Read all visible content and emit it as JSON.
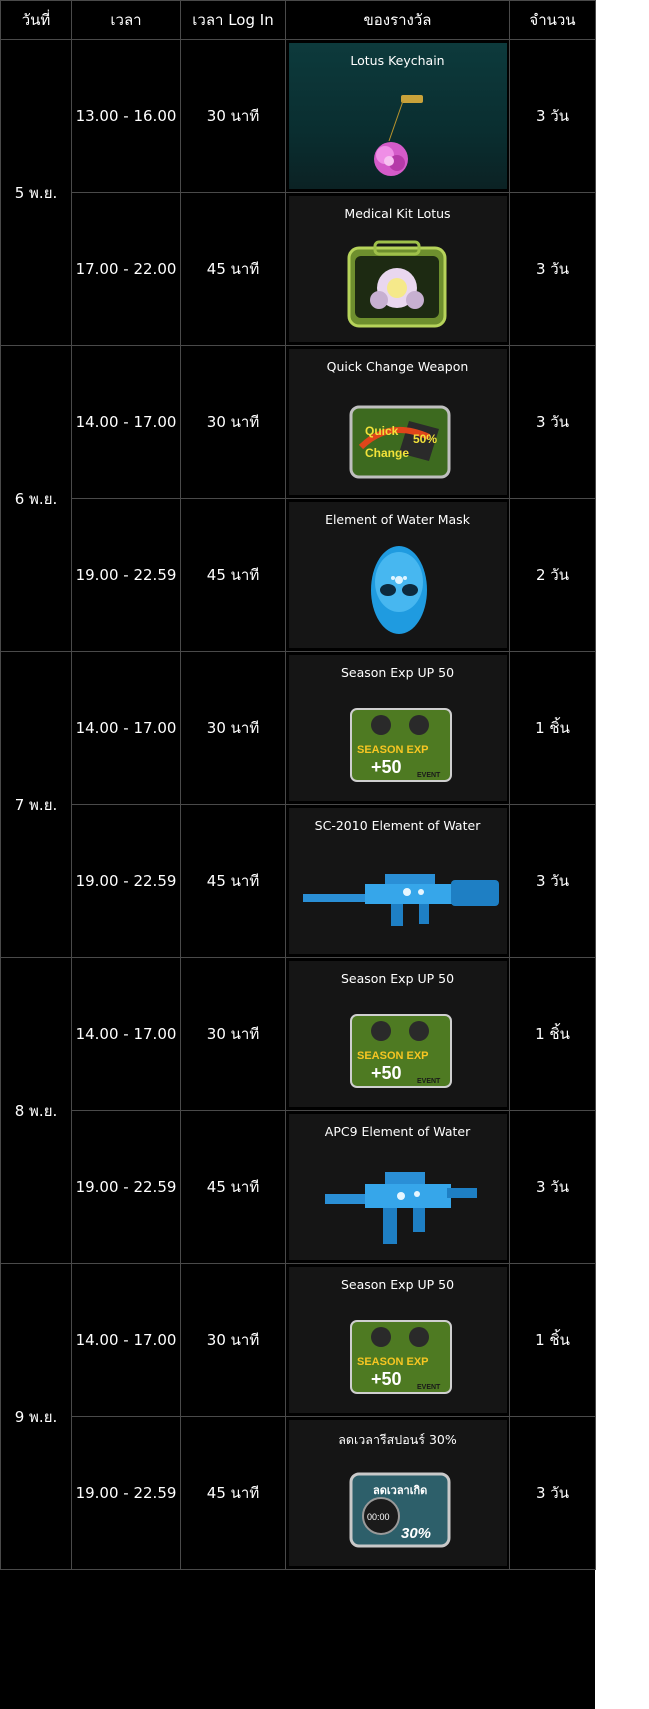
{
  "headers": {
    "day": "วันที่",
    "time": "เวลา",
    "login": "เวลา Log In",
    "prize": "ของรางวัล",
    "amount": "จำนวน"
  },
  "days": [
    {
      "date": "5 พ.ย.",
      "rows": [
        {
          "time": "13.00 - 16.00",
          "login": "30 นาที",
          "prize": "Lotus Keychain",
          "icon": "lotus-keychain-image",
          "amount": "3 วัน"
        },
        {
          "time": "17.00 - 22.00",
          "login": "45 นาที",
          "prize": "Medical Kit Lotus",
          "icon": "medical-kit-lotus-image",
          "amount": "3 วัน"
        }
      ]
    },
    {
      "date": "6 พ.ย.",
      "rows": [
        {
          "time": "14.00 - 17.00",
          "login": "30 นาที",
          "prize": "Quick Change Weapon",
          "icon": "quick-change-weapon-image",
          "amount": "3 วัน",
          "badge": {
            "line1": "Quick",
            "line2": "Change",
            "pct": "50%"
          }
        },
        {
          "time": "19.00 - 22.59",
          "login": "45 นาที",
          "prize": "Element of Water Mask",
          "icon": "water-mask-image",
          "amount": "2 วัน"
        }
      ]
    },
    {
      "date": "7 พ.ย.",
      "rows": [
        {
          "time": "14.00 - 17.00",
          "login": "30 นาที",
          "prize": "Season Exp UP 50",
          "icon": "season-exp-image",
          "amount": "1 ชิ้น",
          "badge": {
            "line1": "SEASON EXP",
            "line2": "+50",
            "tag": "EVENT"
          }
        },
        {
          "time": "19.00 - 22.59",
          "login": "45 นาที",
          "prize": "SC-2010 Element of Water",
          "icon": "rifle-image",
          "amount": "3 วัน"
        }
      ]
    },
    {
      "date": "8 พ.ย.",
      "rows": [
        {
          "time": "14.00 - 17.00",
          "login": "30 นาที",
          "prize": "Season Exp UP 50",
          "icon": "season-exp-image",
          "amount": "1 ชิ้น",
          "badge": {
            "line1": "SEASON EXP",
            "line2": "+50",
            "tag": "EVENT"
          }
        },
        {
          "time": "19.00 - 22.59",
          "login": "45 นาที",
          "prize": "APC9 Element of Water",
          "icon": "smg-image",
          "amount": "3 วัน"
        }
      ]
    },
    {
      "date": "9 พ.ย.",
      "rows": [
        {
          "time": "14.00 - 17.00",
          "login": "30 นาที",
          "prize": "Season Exp UP 50",
          "icon": "season-exp-image",
          "amount": "1 ชิ้น",
          "badge": {
            "line1": "SEASON EXP",
            "line2": "+50",
            "tag": "EVENT"
          }
        },
        {
          "time": "19.00 - 22.59",
          "login": "45 นาที",
          "prize": "ลดเวลารีสปอนร์ 30%",
          "icon": "respawn-reduce-image",
          "amount": "3 วัน",
          "badge": {
            "line1": "ลดเวลาเกิด",
            "line2": "00:00",
            "pct": "30%"
          }
        }
      ]
    }
  ]
}
